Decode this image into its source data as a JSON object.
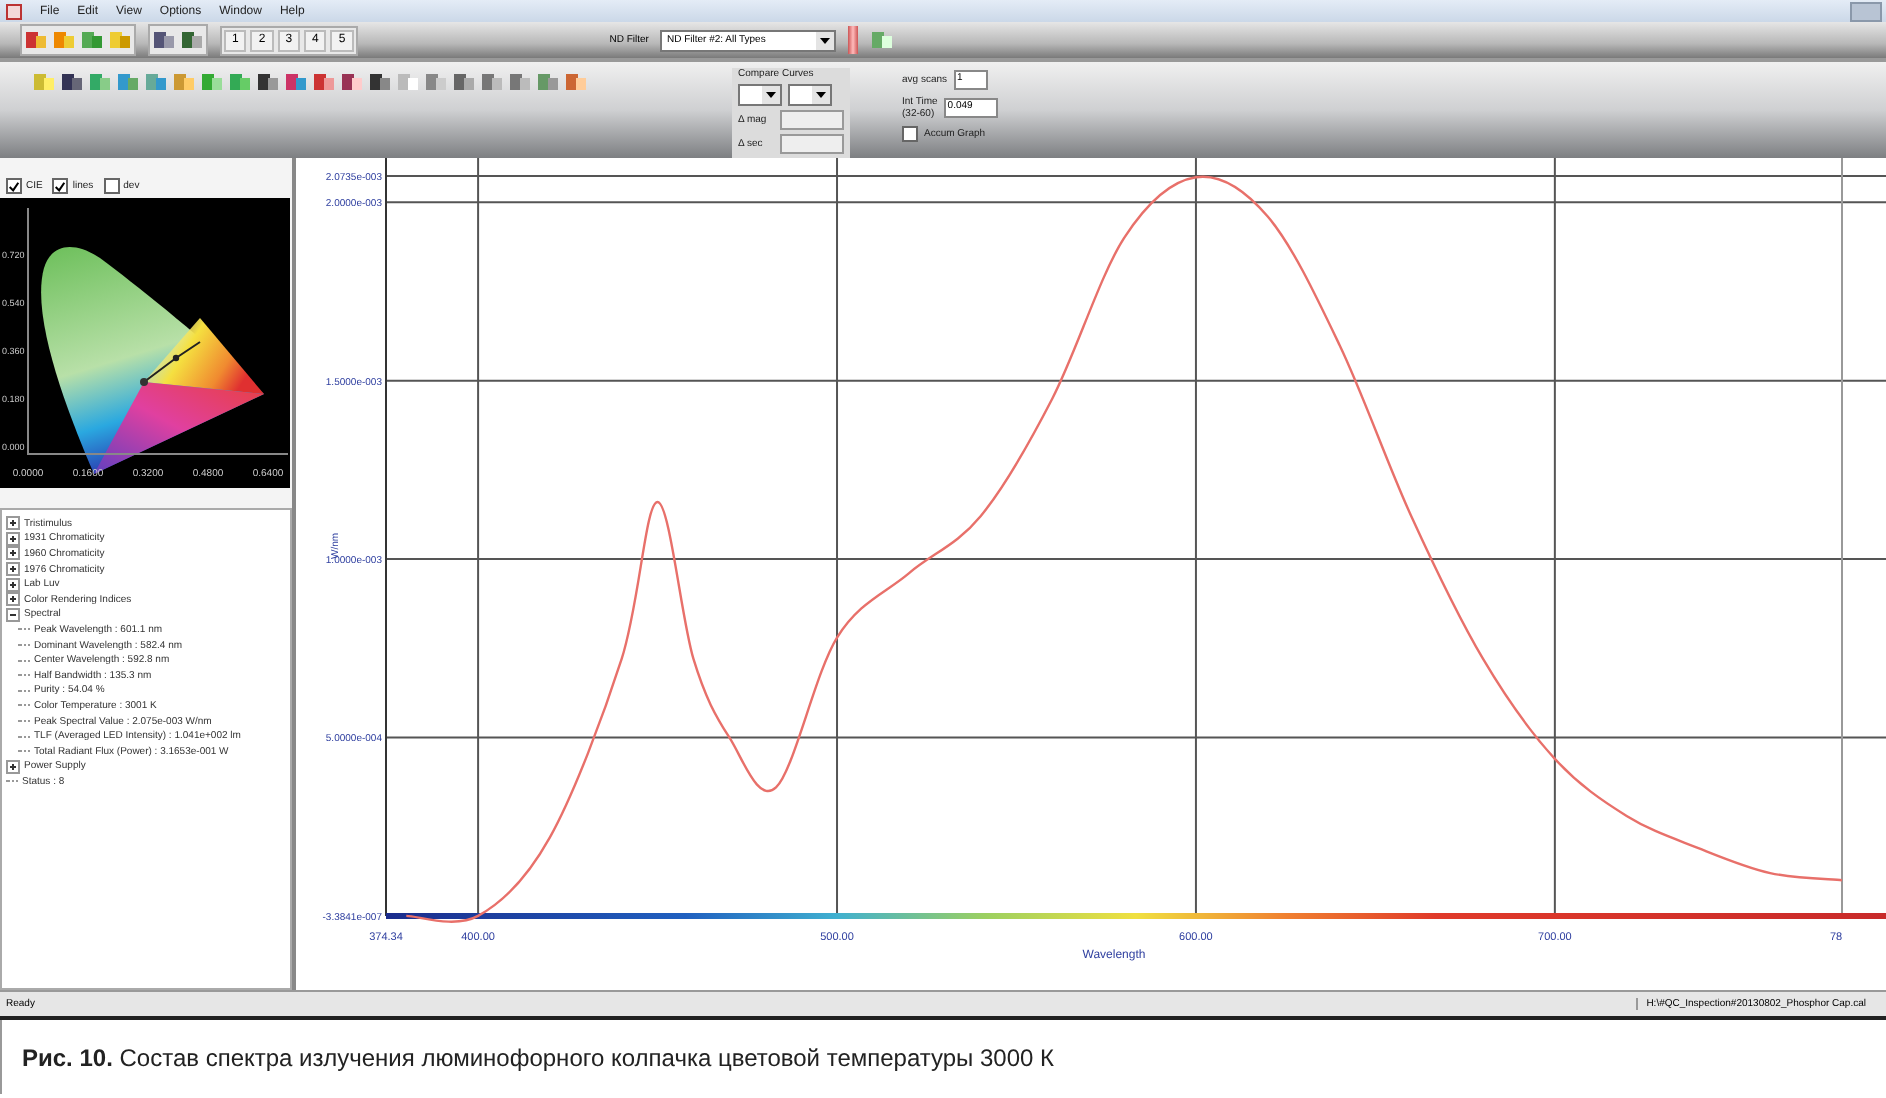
{
  "menu": [
    "File",
    "Edit",
    "View",
    "Options",
    "Window",
    "Help"
  ],
  "toolbar": {
    "page_buttons": [
      "1",
      "2",
      "3",
      "4",
      "5"
    ],
    "nd_filter_label": "ND Filter",
    "nd_filter_value": "ND Filter #2: All Types"
  },
  "acquisition": {
    "compare_label": "Compare Curves",
    "mag_label": "Δ mag",
    "sec_label": "Δ sec",
    "avg_label": "avg scans",
    "avg_value": "1",
    "int_label": "Int Time",
    "int_range": "(32-60)",
    "int_value": "0.049",
    "accum": {
      "label": "Accum Graph",
      "checked": false
    }
  },
  "cie": {
    "options": [
      {
        "label": "CIE",
        "checked": true
      },
      {
        "label": "lines",
        "checked": true
      },
      {
        "label": "dev",
        "checked": false
      }
    ],
    "xticks": [
      "0.0000",
      "0.1600",
      "0.3200",
      "0.4800",
      "0.6400"
    ],
    "yticks": [
      "0.720",
      "0.540",
      "0.360",
      "0.180",
      "0.000"
    ]
  },
  "tree": [
    {
      "label": "Tristimulus",
      "expanded": false
    },
    {
      "label": "1931 Chromaticity",
      "expanded": false
    },
    {
      "label": "1960 Chromaticity",
      "expanded": false
    },
    {
      "label": "1976 Chromaticity",
      "expanded": false
    },
    {
      "label": "Lab Luv",
      "expanded": false
    },
    {
      "label": "Color Rendering Indices",
      "expanded": false
    },
    {
      "label": "Spectral",
      "expanded": true,
      "children": [
        {
          "label": "Peak Wavelength : 601.1 nm"
        },
        {
          "label": "Dominant Wavelength : 582.4 nm"
        },
        {
          "label": "Center Wavelength : 592.8 nm"
        },
        {
          "label": "Half Bandwidth : 135.3 nm"
        },
        {
          "label": "Purity : 54.04 %"
        },
        {
          "label": "Color Temperature : 3001 K"
        },
        {
          "label": "Peak Spectral Value : 2.075e-003 W/nm"
        },
        {
          "label": "TLF (Averaged LED Intensity) : 1.041e+002 lm"
        },
        {
          "label": "Total Radiant Flux (Power) : 3.1653e-001 W"
        }
      ]
    },
    {
      "label": "Power Supply",
      "expanded": false
    },
    {
      "label": "Status : 8",
      "kind": "leaf"
    }
  ],
  "chart": {
    "chart_data": {
      "type": "line",
      "xlabel": "Wavelength",
      "ylabel": "W/nm",
      "x": [
        380,
        400,
        420,
        440,
        450,
        460,
        470,
        483,
        500,
        520,
        540,
        560,
        580,
        600,
        620,
        640,
        660,
        680,
        700,
        720,
        740,
        760,
        780
      ],
      "series": [
        {
          "color": "#e8706a",
          "values": [
            0,
            0,
            0.00022,
            0.00072,
            0.00116,
            0.00072,
            0.0005,
            0.00036,
            0.00078,
            0.00096,
            0.00112,
            0.00145,
            0.0019,
            0.00207,
            0.00196,
            0.0016,
            0.00112,
            0.00072,
            0.00044,
            0.00028,
            0.00019,
            0.00012,
            0.0001
          ]
        }
      ],
      "xlim": [
        374.34,
        780
      ],
      "ylim": [
        -3.3841e-07,
        0.0020735
      ],
      "xticks": [
        {
          "value": 374.34,
          "label": "374.34"
        },
        {
          "value": 400,
          "label": "400.00"
        },
        {
          "value": 500,
          "label": "500.00"
        },
        {
          "value": 600,
          "label": "600.00"
        },
        {
          "value": 700,
          "label": "700.00"
        }
      ],
      "grid": true,
      "yticks": [
        {
          "value": -3.3841e-07,
          "label": "-3.3841e-007"
        },
        {
          "value": 0.0005,
          "label": "5.0000e-004"
        },
        {
          "value": 0.001,
          "label": "1.0000e-003"
        },
        {
          "value": 0.0015,
          "label": "1.5000e-003"
        },
        {
          "value": 0.002,
          "label": "2.0000e-003"
        },
        {
          "value": 0.0020735,
          "label": "2.0735e-003"
        }
      ]
    },
    "cut_tick_label": "78"
  },
  "status_bar": {
    "left": "Ready",
    "right": "H:\\#QC_Inspection#20130802_Phosphor Cap.cal"
  },
  "caption": "**Рис. 10.** Состав спектра излучения люминофорного колпачка цветовой температуры 3000 К"
}
